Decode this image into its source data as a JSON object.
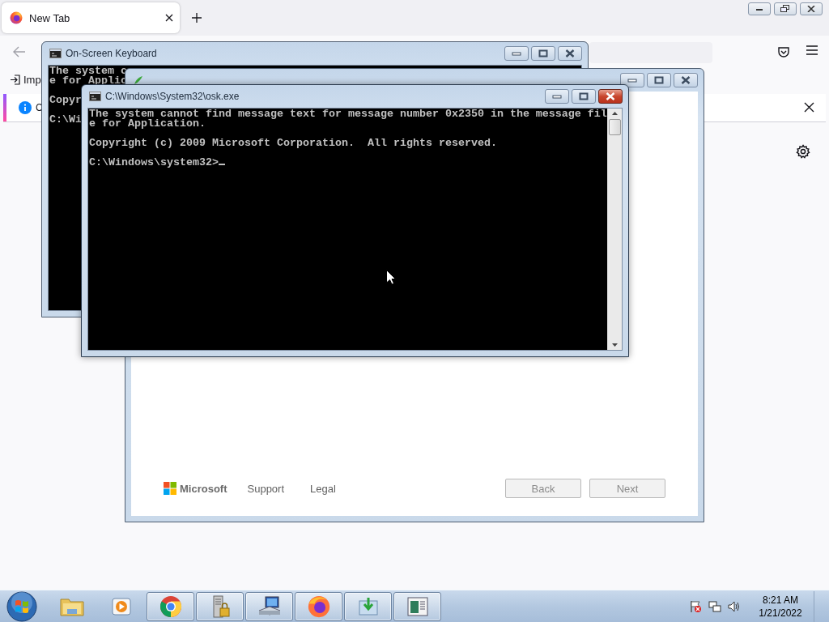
{
  "browser": {
    "tab": {
      "title": "New Tab",
      "selected": true
    },
    "bookmark": "Imp",
    "notification": "C"
  },
  "windows": [
    {
      "kind": "console",
      "title": "On-Screen Keyboard",
      "active": false,
      "paragraphs": [
        {
          "lines": [
            "The system c",
            "e for Applic"
          ]
        },
        {
          "lines": [
            "Copyr"
          ]
        },
        {
          "lines": [
            "C:\\Wi"
          ]
        }
      ]
    },
    {
      "kind": "setup",
      "active": false,
      "footer": {
        "brand": "Microsoft",
        "links": [
          "Support",
          "Legal"
        ],
        "buttons": [
          {
            "label": "Back",
            "disabled": true
          },
          {
            "label": "Next",
            "disabled": true
          }
        ]
      }
    },
    {
      "kind": "console",
      "title": "C:\\Windows\\System32\\osk.exe",
      "active": true,
      "paragraphs": [
        {
          "lines": [
            "The system cannot find message text for message number 0x2350 in the message fil",
            "e for Application."
          ]
        },
        {
          "lines": [
            "Copyright (c) 2009 Microsoft Corporation.  All rights reserved."
          ]
        },
        {
          "lines": [
            "C:\\Windows\\system32>"
          ]
        }
      ]
    }
  ],
  "taskbar": {
    "apps": [
      {
        "running": false
      },
      {
        "running": false
      },
      {
        "running": true
      },
      {
        "running": true
      },
      {
        "running": true
      },
      {
        "running": true
      },
      {
        "running": true
      },
      {
        "running": true
      }
    ],
    "clock": {
      "time": "8:21 AM",
      "date": "1/21/2022"
    }
  }
}
